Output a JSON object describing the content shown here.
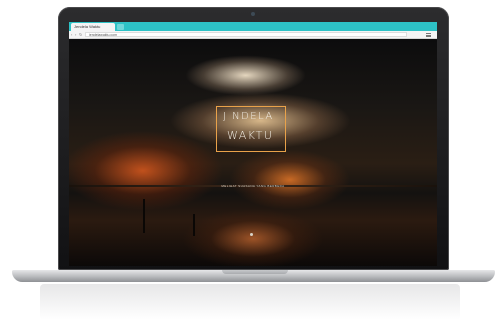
{
  "browser": {
    "tab_title": "Jendela Waktu",
    "url": "jendelawaktu.com"
  },
  "site": {
    "logo_line1": "J NDELA",
    "logo_line2": "WAKTU",
    "tagline": "MELIHAT SUASANA YANG BERBEDA",
    "accent_color": "#e9a24a"
  },
  "icons": {
    "back": "back-arrow-icon",
    "forward": "forward-arrow-icon",
    "reload": "reload-icon",
    "menu": "menu-icon",
    "scroll": "scroll-down-dot-icon"
  }
}
